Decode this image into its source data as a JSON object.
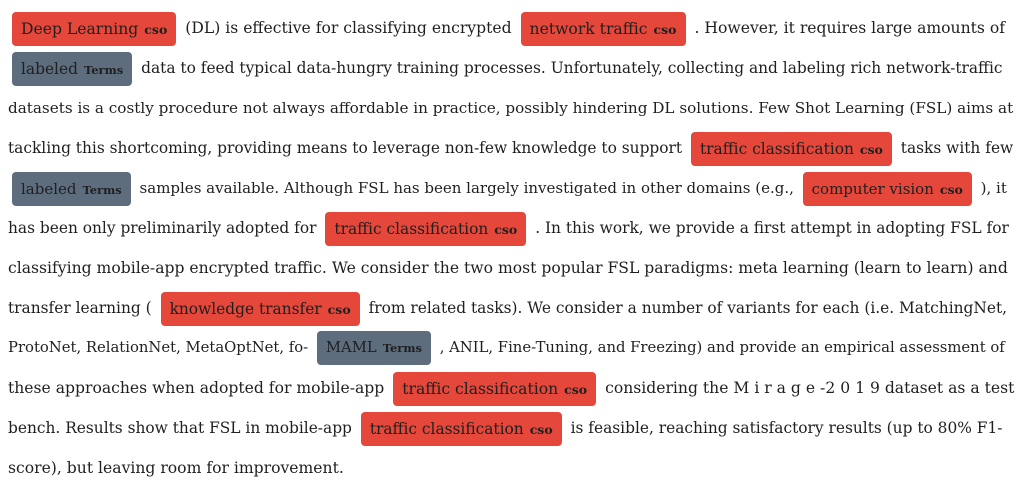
{
  "colors": {
    "cso": "#e5473b",
    "terms": "#5d6d7e"
  },
  "lines": [
    [
      {
        "ent": "Deep Learning",
        "label": "cso"
      },
      {
        "t": "(DL) is effective for classifying encrypted"
      },
      {
        "ent": "network traffic",
        "label": "cso"
      },
      {
        "t": ". However, it requires large amounts of"
      }
    ],
    [
      {
        "ent": "labeled",
        "label": "Terms"
      },
      {
        "t": "data to feed typical data-hungry training processes. Unfortunately, collecting and labeling rich network-traffic"
      }
    ],
    [
      {
        "t": "datasets is a costly procedure not always affordable in practice, possibly hindering DL solutions. Few Shot Learning (FSL) aims at"
      }
    ],
    [
      {
        "t": "tackling this shortcoming, providing means to leverage non-few knowledge to support"
      },
      {
        "ent": "traffic classification",
        "label": "cso"
      },
      {
        "t": "tasks with few"
      }
    ],
    [
      {
        "ent": "labeled",
        "label": "Terms"
      },
      {
        "t": "samples available. Although FSL has been largely investigated in other domains (e.g.,"
      },
      {
        "ent": "computer vision",
        "label": "cso"
      },
      {
        "t": "), it"
      }
    ],
    [
      {
        "t": "has been only preliminarily adopted for"
      },
      {
        "ent": "traffic classification",
        "label": "cso"
      },
      {
        "t": ". In this work, we provide a first attempt in adopting FSL for"
      }
    ],
    [
      {
        "t": "classifying mobile-app encrypted traffic. We consider the two most popular FSL paradigms: meta learning (learn to learn) and"
      }
    ],
    [
      {
        "t": "transfer learning ("
      },
      {
        "ent": "knowledge transfer",
        "label": "cso"
      },
      {
        "t": "from related tasks). We consider a number of variants for each (i.e. MatchingNet,"
      }
    ],
    [
      {
        "t": "ProtoNet, RelationNet, MetaOptNet, fo-"
      },
      {
        "ent": "MAML",
        "label": "Terms"
      },
      {
        "t": ", ANIL, Fine-Tuning, and Freezing) and provide an empirical assessment of"
      }
    ],
    [
      {
        "t": "these approaches when adopted for mobile-app"
      },
      {
        "ent": "traffic classification",
        "label": "cso"
      },
      {
        "t": "considering the M i r a g e -2 0 1 9 dataset as a test"
      }
    ],
    [
      {
        "t": "bench. Results show that FSL in mobile-app"
      },
      {
        "ent": "traffic classification",
        "label": "cso"
      },
      {
        "t": "is feasible, reaching satisfactory results (up to 80% F1-"
      }
    ],
    [
      {
        "t": "score), but leaving room for improvement."
      }
    ]
  ]
}
